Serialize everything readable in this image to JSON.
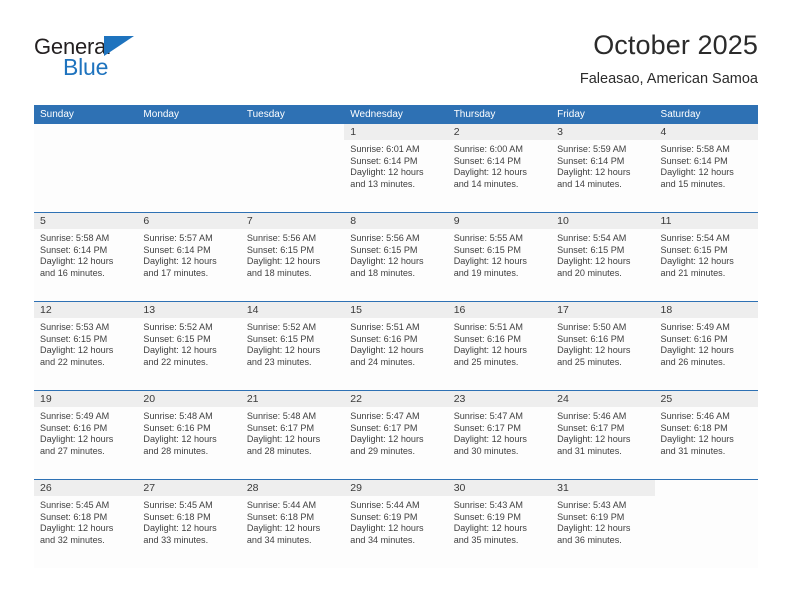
{
  "brand": {
    "name_part1": "General",
    "name_part2": "Blue",
    "triangle_icon": "triangle-icon",
    "color_dark": "#231f20",
    "color_blue": "#1e73be"
  },
  "header": {
    "title": "October 2025",
    "subtitle": "Faleasao, American Samoa"
  },
  "theme": {
    "header_bar": "#2e71b4",
    "day_band": "#eeeeee",
    "cell_bg": "#fdfdfd",
    "text": "#404040"
  },
  "weekdays": [
    "Sunday",
    "Monday",
    "Tuesday",
    "Wednesday",
    "Thursday",
    "Friday",
    "Saturday"
  ],
  "weeks": [
    [
      {
        "day": "",
        "blank": true,
        "sunrise": "",
        "sunset": "",
        "daylight1": "",
        "daylight2": ""
      },
      {
        "day": "",
        "blank": true,
        "sunrise": "",
        "sunset": "",
        "daylight1": "",
        "daylight2": ""
      },
      {
        "day": "",
        "blank": true,
        "sunrise": "",
        "sunset": "",
        "daylight1": "",
        "daylight2": ""
      },
      {
        "day": "1",
        "sunrise": "Sunrise: 6:01 AM",
        "sunset": "Sunset: 6:14 PM",
        "daylight1": "Daylight: 12 hours",
        "daylight2": "and 13 minutes."
      },
      {
        "day": "2",
        "sunrise": "Sunrise: 6:00 AM",
        "sunset": "Sunset: 6:14 PM",
        "daylight1": "Daylight: 12 hours",
        "daylight2": "and 14 minutes."
      },
      {
        "day": "3",
        "sunrise": "Sunrise: 5:59 AM",
        "sunset": "Sunset: 6:14 PM",
        "daylight1": "Daylight: 12 hours",
        "daylight2": "and 14 minutes."
      },
      {
        "day": "4",
        "sunrise": "Sunrise: 5:58 AM",
        "sunset": "Sunset: 6:14 PM",
        "daylight1": "Daylight: 12 hours",
        "daylight2": "and 15 minutes."
      }
    ],
    [
      {
        "day": "5",
        "sunrise": "Sunrise: 5:58 AM",
        "sunset": "Sunset: 6:14 PM",
        "daylight1": "Daylight: 12 hours",
        "daylight2": "and 16 minutes."
      },
      {
        "day": "6",
        "sunrise": "Sunrise: 5:57 AM",
        "sunset": "Sunset: 6:14 PM",
        "daylight1": "Daylight: 12 hours",
        "daylight2": "and 17 minutes."
      },
      {
        "day": "7",
        "sunrise": "Sunrise: 5:56 AM",
        "sunset": "Sunset: 6:15 PM",
        "daylight1": "Daylight: 12 hours",
        "daylight2": "and 18 minutes."
      },
      {
        "day": "8",
        "sunrise": "Sunrise: 5:56 AM",
        "sunset": "Sunset: 6:15 PM",
        "daylight1": "Daylight: 12 hours",
        "daylight2": "and 18 minutes."
      },
      {
        "day": "9",
        "sunrise": "Sunrise: 5:55 AM",
        "sunset": "Sunset: 6:15 PM",
        "daylight1": "Daylight: 12 hours",
        "daylight2": "and 19 minutes."
      },
      {
        "day": "10",
        "sunrise": "Sunrise: 5:54 AM",
        "sunset": "Sunset: 6:15 PM",
        "daylight1": "Daylight: 12 hours",
        "daylight2": "and 20 minutes."
      },
      {
        "day": "11",
        "sunrise": "Sunrise: 5:54 AM",
        "sunset": "Sunset: 6:15 PM",
        "daylight1": "Daylight: 12 hours",
        "daylight2": "and 21 minutes."
      }
    ],
    [
      {
        "day": "12",
        "sunrise": "Sunrise: 5:53 AM",
        "sunset": "Sunset: 6:15 PM",
        "daylight1": "Daylight: 12 hours",
        "daylight2": "and 22 minutes."
      },
      {
        "day": "13",
        "sunrise": "Sunrise: 5:52 AM",
        "sunset": "Sunset: 6:15 PM",
        "daylight1": "Daylight: 12 hours",
        "daylight2": "and 22 minutes."
      },
      {
        "day": "14",
        "sunrise": "Sunrise: 5:52 AM",
        "sunset": "Sunset: 6:15 PM",
        "daylight1": "Daylight: 12 hours",
        "daylight2": "and 23 minutes."
      },
      {
        "day": "15",
        "sunrise": "Sunrise: 5:51 AM",
        "sunset": "Sunset: 6:16 PM",
        "daylight1": "Daylight: 12 hours",
        "daylight2": "and 24 minutes."
      },
      {
        "day": "16",
        "sunrise": "Sunrise: 5:51 AM",
        "sunset": "Sunset: 6:16 PM",
        "daylight1": "Daylight: 12 hours",
        "daylight2": "and 25 minutes."
      },
      {
        "day": "17",
        "sunrise": "Sunrise: 5:50 AM",
        "sunset": "Sunset: 6:16 PM",
        "daylight1": "Daylight: 12 hours",
        "daylight2": "and 25 minutes."
      },
      {
        "day": "18",
        "sunrise": "Sunrise: 5:49 AM",
        "sunset": "Sunset: 6:16 PM",
        "daylight1": "Daylight: 12 hours",
        "daylight2": "and 26 minutes."
      }
    ],
    [
      {
        "day": "19",
        "sunrise": "Sunrise: 5:49 AM",
        "sunset": "Sunset: 6:16 PM",
        "daylight1": "Daylight: 12 hours",
        "daylight2": "and 27 minutes."
      },
      {
        "day": "20",
        "sunrise": "Sunrise: 5:48 AM",
        "sunset": "Sunset: 6:16 PM",
        "daylight1": "Daylight: 12 hours",
        "daylight2": "and 28 minutes."
      },
      {
        "day": "21",
        "sunrise": "Sunrise: 5:48 AM",
        "sunset": "Sunset: 6:17 PM",
        "daylight1": "Daylight: 12 hours",
        "daylight2": "and 28 minutes."
      },
      {
        "day": "22",
        "sunrise": "Sunrise: 5:47 AM",
        "sunset": "Sunset: 6:17 PM",
        "daylight1": "Daylight: 12 hours",
        "daylight2": "and 29 minutes."
      },
      {
        "day": "23",
        "sunrise": "Sunrise: 5:47 AM",
        "sunset": "Sunset: 6:17 PM",
        "daylight1": "Daylight: 12 hours",
        "daylight2": "and 30 minutes."
      },
      {
        "day": "24",
        "sunrise": "Sunrise: 5:46 AM",
        "sunset": "Sunset: 6:17 PM",
        "daylight1": "Daylight: 12 hours",
        "daylight2": "and 31 minutes."
      },
      {
        "day": "25",
        "sunrise": "Sunrise: 5:46 AM",
        "sunset": "Sunset: 6:18 PM",
        "daylight1": "Daylight: 12 hours",
        "daylight2": "and 31 minutes."
      }
    ],
    [
      {
        "day": "26",
        "sunrise": "Sunrise: 5:45 AM",
        "sunset": "Sunset: 6:18 PM",
        "daylight1": "Daylight: 12 hours",
        "daylight2": "and 32 minutes."
      },
      {
        "day": "27",
        "sunrise": "Sunrise: 5:45 AM",
        "sunset": "Sunset: 6:18 PM",
        "daylight1": "Daylight: 12 hours",
        "daylight2": "and 33 minutes."
      },
      {
        "day": "28",
        "sunrise": "Sunrise: 5:44 AM",
        "sunset": "Sunset: 6:18 PM",
        "daylight1": "Daylight: 12 hours",
        "daylight2": "and 34 minutes."
      },
      {
        "day": "29",
        "sunrise": "Sunrise: 5:44 AM",
        "sunset": "Sunset: 6:19 PM",
        "daylight1": "Daylight: 12 hours",
        "daylight2": "and 34 minutes."
      },
      {
        "day": "30",
        "sunrise": "Sunrise: 5:43 AM",
        "sunset": "Sunset: 6:19 PM",
        "daylight1": "Daylight: 12 hours",
        "daylight2": "and 35 minutes."
      },
      {
        "day": "31",
        "sunrise": "Sunrise: 5:43 AM",
        "sunset": "Sunset: 6:19 PM",
        "daylight1": "Daylight: 12 hours",
        "daylight2": "and 36 minutes."
      },
      {
        "day": "",
        "empty": true,
        "blank": true,
        "sunrise": "",
        "sunset": "",
        "daylight1": "",
        "daylight2": ""
      }
    ]
  ]
}
